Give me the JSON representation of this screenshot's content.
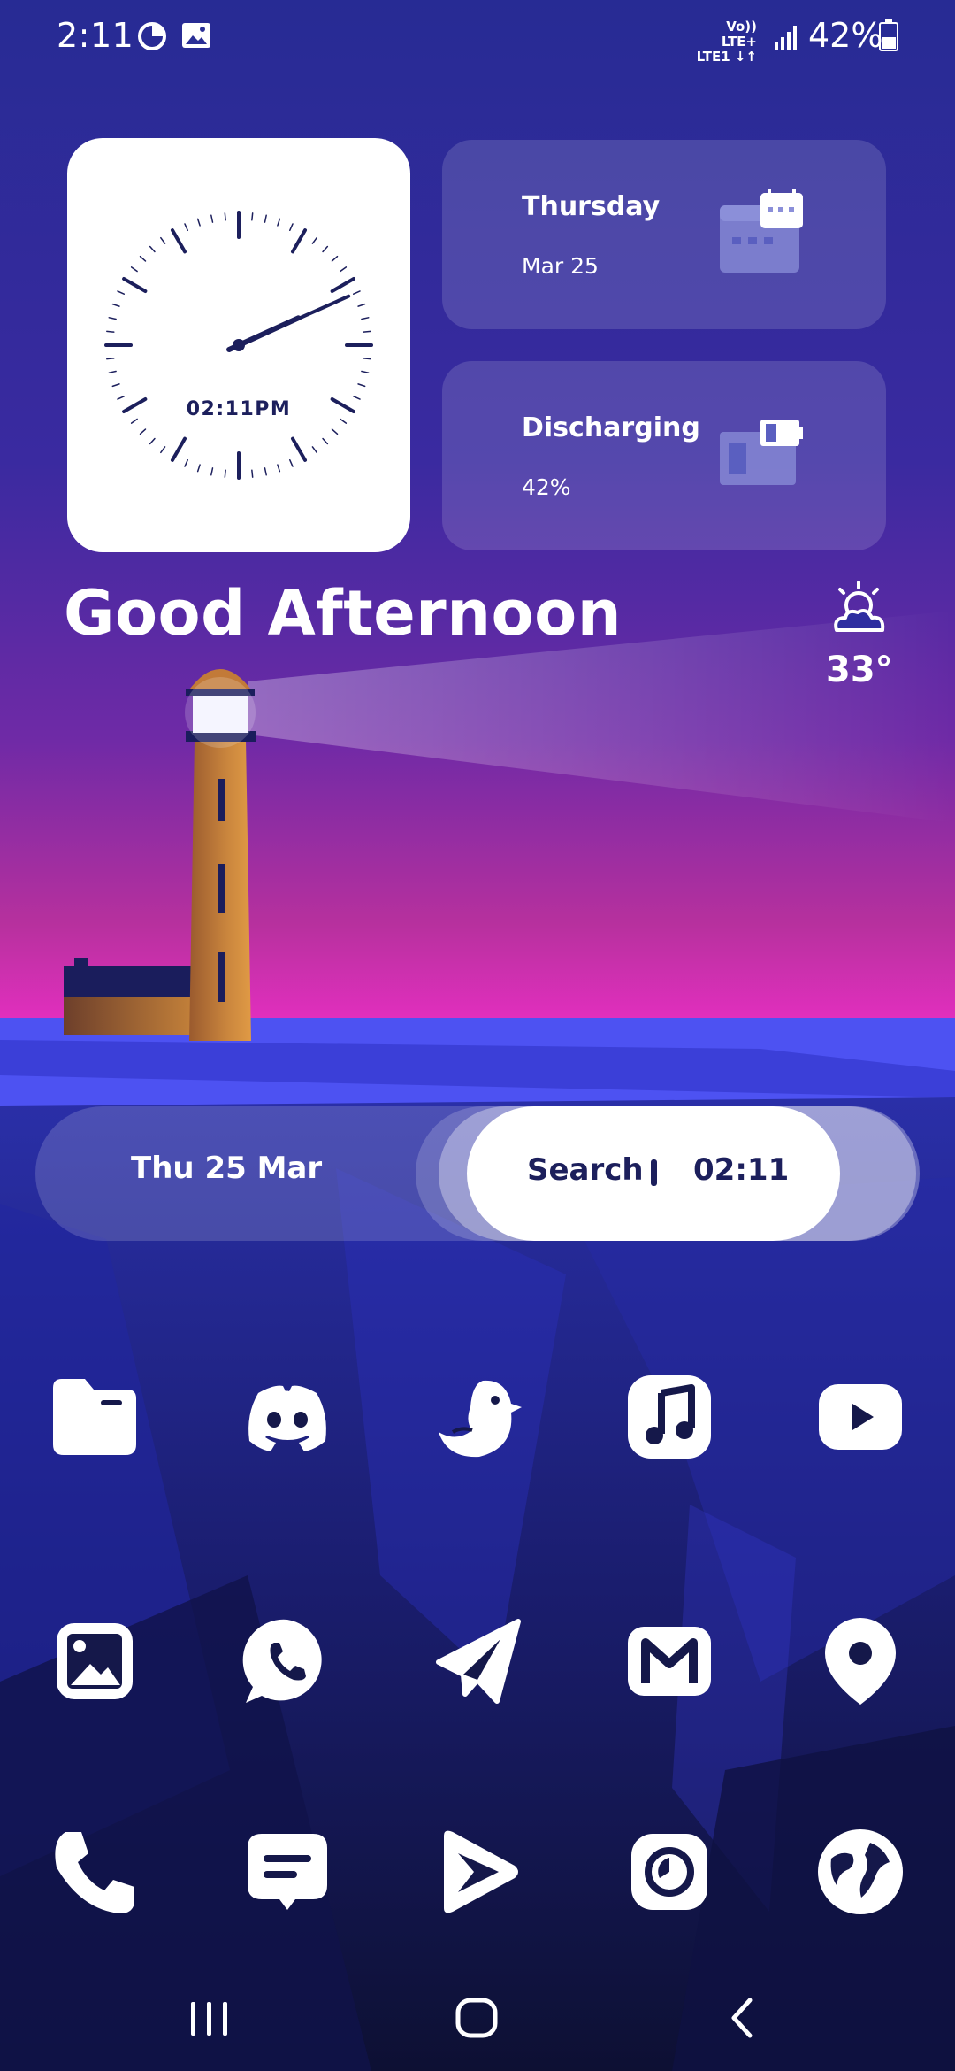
{
  "status_bar": {
    "time": "2:11",
    "network_line1": "Vo)) LTE+",
    "network_line2": "LTE1 ↓↑",
    "battery": "42%",
    "icons": [
      "data-saver-icon",
      "gallery-icon",
      "signal-icon",
      "battery-icon"
    ]
  },
  "clock_widget": {
    "digital": "02:11PM",
    "hour": 2,
    "minute": 11
  },
  "calendar_card": {
    "title": "Thursday",
    "subtitle": "Mar 25",
    "icon": "calendar-icon"
  },
  "battery_card": {
    "title": "Discharging",
    "subtitle": "42%",
    "icon": "battery-status-icon"
  },
  "greeting": "Good Afternoon",
  "weather": {
    "temp": "33°",
    "icon": "partly-cloudy-sun-icon"
  },
  "search_pill": {
    "date": "Thu 25 Mar",
    "search_label": "Search",
    "time": "02:11"
  },
  "apps": [
    {
      "icon": "files-icon"
    },
    {
      "icon": "discord-icon"
    },
    {
      "icon": "bird-icon"
    },
    {
      "icon": "music-icon"
    },
    {
      "icon": "youtube-icon"
    },
    {
      "icon": "gallery-icon"
    },
    {
      "icon": "whatsapp-icon"
    },
    {
      "icon": "telegram-icon"
    },
    {
      "icon": "gmail-icon"
    },
    {
      "icon": "maps-icon"
    },
    {
      "icon": "phone-icon"
    },
    {
      "icon": "messages-icon"
    },
    {
      "icon": "play-store-icon"
    },
    {
      "icon": "clock-icon"
    },
    {
      "icon": "browser-icon"
    }
  ],
  "nav": {
    "buttons": [
      "recents-button",
      "home-button",
      "back-button"
    ]
  },
  "colors": {
    "accent_dark": "#1c1f5c",
    "sky_top": "#2a2f96",
    "horizon_pink": "#e62fc2",
    "sea_blue": "#4b4ff0"
  }
}
